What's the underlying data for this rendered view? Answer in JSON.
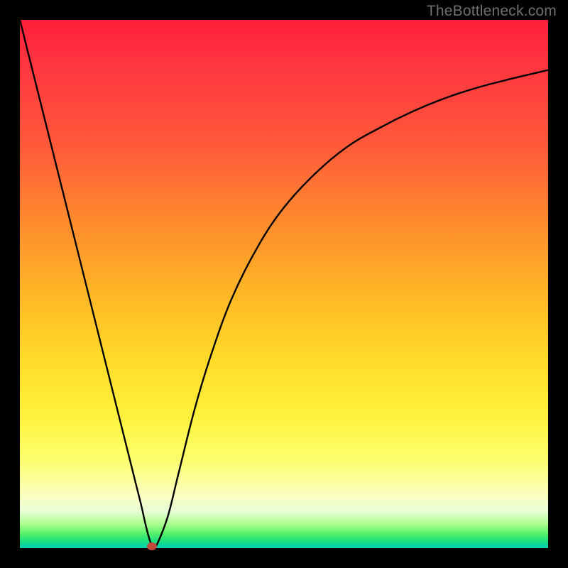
{
  "watermark": {
    "text": "TheBottleneck.com"
  },
  "chart_data": {
    "type": "line",
    "title": "",
    "xlabel": "",
    "ylabel": "",
    "xlim": [
      0,
      100
    ],
    "ylim": [
      0,
      100
    ],
    "grid": false,
    "legend": false,
    "series": [
      {
        "name": "curve",
        "x": [
          0,
          3,
          6,
          9,
          12,
          15,
          18,
          20,
          21,
          22,
          23,
          23.9,
          24.7,
          25.4,
          26,
          28,
          30,
          33,
          36,
          40,
          45,
          50,
          56,
          62,
          68,
          74,
          80,
          86,
          92,
          100
        ],
        "y": [
          100,
          88,
          76,
          64,
          52,
          40,
          28,
          20,
          16,
          12,
          8,
          4,
          1.2,
          0.4,
          0.8,
          6,
          14,
          26,
          36,
          47,
          57,
          64.5,
          71,
          76,
          79.5,
          82.5,
          85,
          87,
          88.6,
          90.5
        ]
      }
    ],
    "marker": {
      "x": 25,
      "y": 0.4,
      "color": "#c14b3a"
    },
    "background_gradient": {
      "direction": "vertical_top_to_bottom",
      "stops": [
        {
          "pos": 0.0,
          "color": "#ff1f3a"
        },
        {
          "pos": 0.24,
          "color": "#ff5a3a"
        },
        {
          "pos": 0.52,
          "color": "#ffb726"
        },
        {
          "pos": 0.75,
          "color": "#fff23c"
        },
        {
          "pos": 0.9,
          "color": "#fbffc0"
        },
        {
          "pos": 0.97,
          "color": "#54f06a"
        },
        {
          "pos": 1.0,
          "color": "#06d0b4"
        }
      ]
    }
  }
}
